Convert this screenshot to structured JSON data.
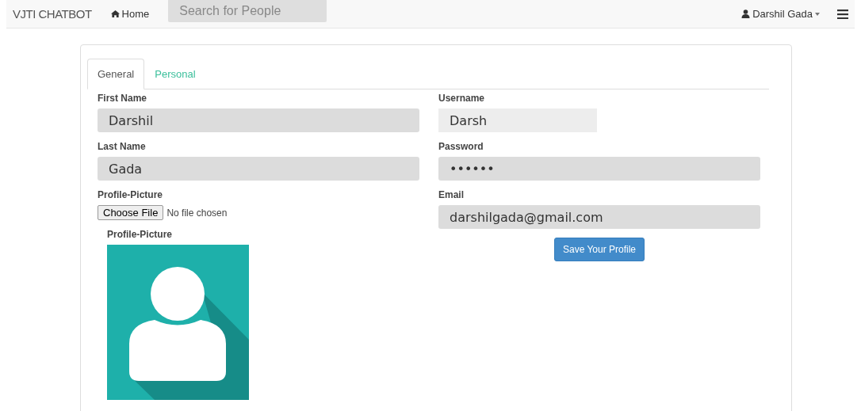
{
  "navbar": {
    "brand": "VJTI CHATBOT",
    "home": "Home",
    "search": {
      "placeholder": "Search for People"
    },
    "user": "Darshil Gada"
  },
  "tabs": [
    {
      "label": "General",
      "selected": true
    },
    {
      "label": "Personal",
      "selected": false
    }
  ],
  "left_fields": [
    {
      "kind": "text",
      "label": "First Name",
      "value": "Darshil"
    },
    {
      "kind": "text",
      "label": "Last Name",
      "value": "Gada"
    },
    {
      "kind": "file",
      "label": "Profile-Picture",
      "button": "Choose File",
      "status": "No file chosen"
    }
  ],
  "picture_caption": "Profile-Picture",
  "right_fields": [
    {
      "kind": "short",
      "label": "Username",
      "value": "Darsh"
    },
    {
      "kind": "text",
      "label": "Password",
      "value": "••••••"
    },
    {
      "kind": "text",
      "label": "Email",
      "value": "darshilgada@gmail.com"
    }
  ],
  "save_button": "Save Your Profile"
}
